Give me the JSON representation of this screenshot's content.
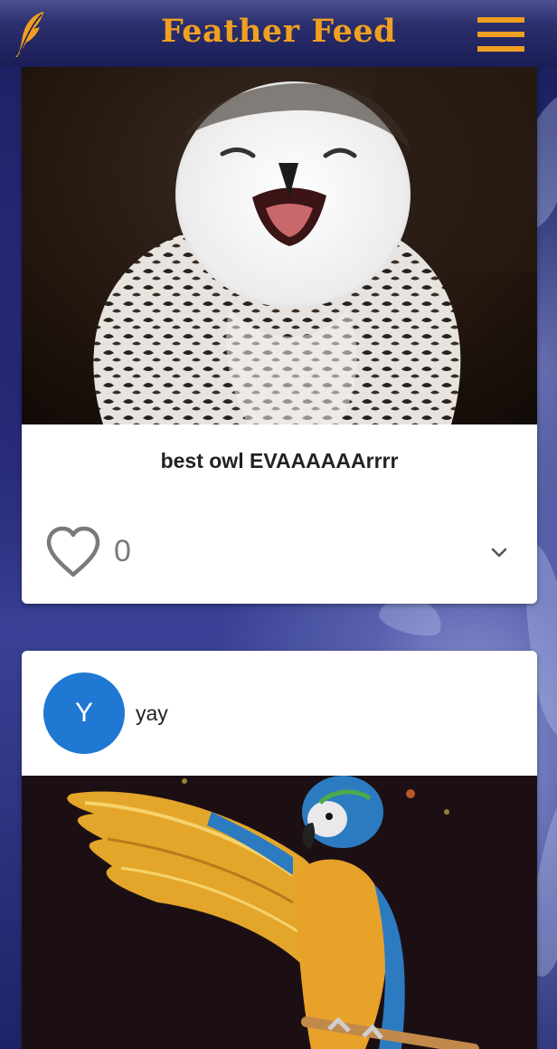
{
  "app": {
    "title": "Feather Feed",
    "accent_color": "#f0a021",
    "header_color": "#1a1d55",
    "logo_icon": "feather-quill-icon",
    "menu_icon": "hamburger-menu-icon"
  },
  "feed": {
    "posts": [
      {
        "image_subject": "snowy owl",
        "caption": "best owl EVAAAAAArrrr",
        "like_icon": "heart-outline-icon",
        "like_count": "0",
        "expand_icon": "chevron-down-icon"
      },
      {
        "avatar_letter": "Y",
        "avatar_color": "#1f78d1",
        "author": "yay",
        "image_subject": "macaw parrot"
      }
    ]
  }
}
